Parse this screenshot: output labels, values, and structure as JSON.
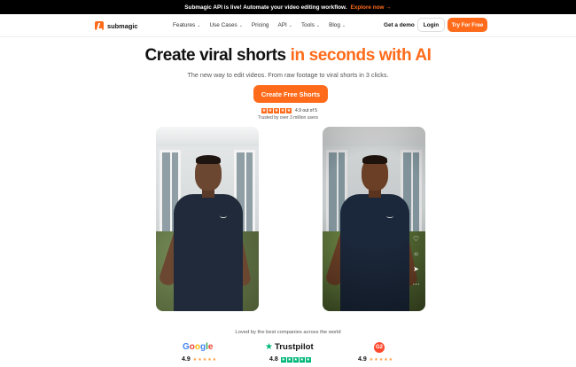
{
  "banner": {
    "text": "Submagic API is live! Automate your video editing workflow.",
    "link": "Explore now →"
  },
  "nav": {
    "logo": "submagic",
    "items": [
      {
        "label": "Features",
        "chevron": true
      },
      {
        "label": "Use Cases",
        "chevron": true
      },
      {
        "label": "Pricing",
        "chevron": false
      },
      {
        "label": "API",
        "chevron": true
      },
      {
        "label": "Tools",
        "chevron": true
      },
      {
        "label": "Blog",
        "chevron": true
      }
    ],
    "demo": "Get a demo",
    "login": "Login",
    "try": "Try For Free"
  },
  "hero": {
    "title_main": "Create viral shorts",
    "title_accent": "in seconds with AI",
    "subtitle": "The new way to edit videos. From raw footage to viral shorts in 3 clicks.",
    "cta": "Create Free Shorts",
    "rating_text": "4.9 out of 5",
    "rating_stars": 5,
    "trusted": "Trusted by over 3 million users"
  },
  "social": {
    "loved": "Loved by the best companies across the world",
    "brands": [
      {
        "name": "Google",
        "score": "4.9"
      },
      {
        "name": "Trustpilot",
        "score": "4.8"
      },
      {
        "name": "G2",
        "score": "4.9"
      }
    ]
  },
  "colors": {
    "accent": "#ff6b1a",
    "trustpilot": "#00b67a",
    "g2": "#ff492c"
  }
}
